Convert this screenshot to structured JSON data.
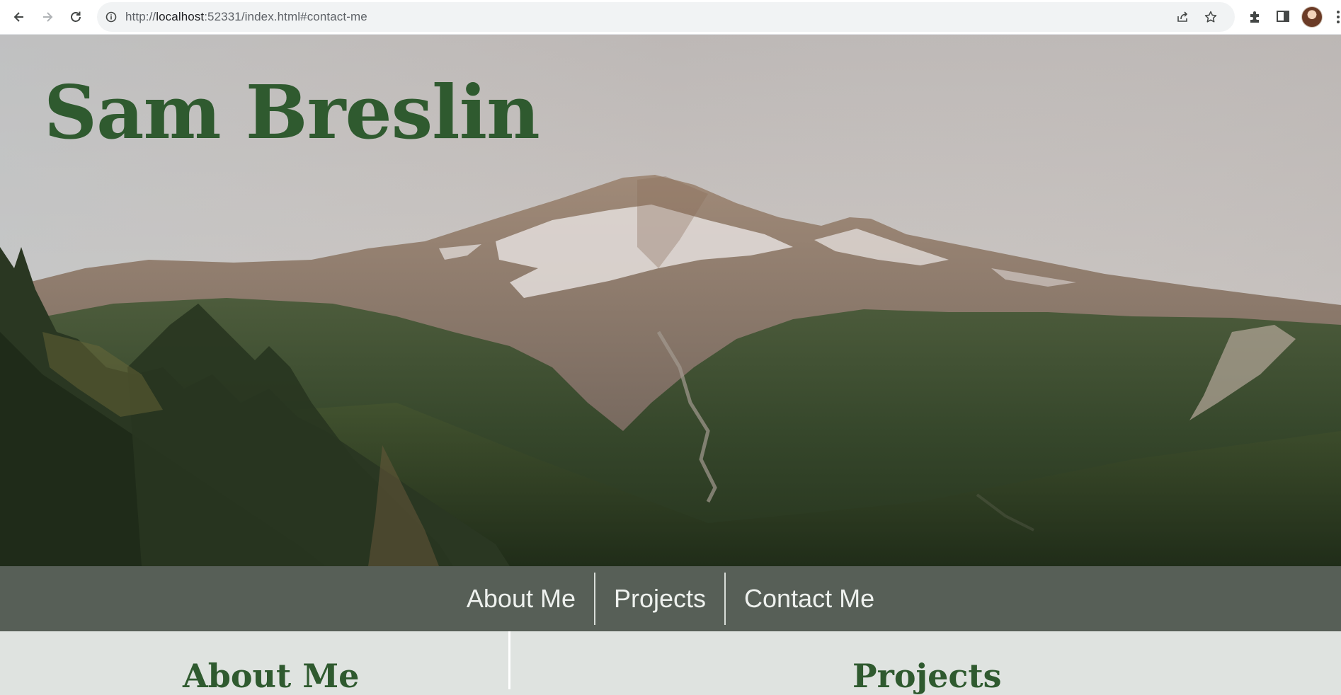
{
  "browser": {
    "url_prefix": "http://",
    "url_host": "localhost",
    "url_rest": ":52331/index.html#contact-me",
    "icons": {
      "back": "back-arrow-icon",
      "forward": "forward-arrow-icon",
      "reload": "reload-icon",
      "info": "info-icon",
      "share": "share-icon",
      "bookmark": "star-icon",
      "extensions": "puzzle-icon",
      "sidepanel": "side-panel-icon",
      "menu": "kebab-menu-icon"
    }
  },
  "hero": {
    "title": "Sam Breslin"
  },
  "nav": {
    "items": [
      {
        "label": "About Me"
      },
      {
        "label": "Projects"
      },
      {
        "label": "Contact Me"
      }
    ]
  },
  "sections": {
    "about_title": "About Me",
    "projects_title": "Projects"
  },
  "colors": {
    "title_green": "#2f5a2f",
    "navbar": "#575f57",
    "content_bg": "#dfe3e0"
  }
}
